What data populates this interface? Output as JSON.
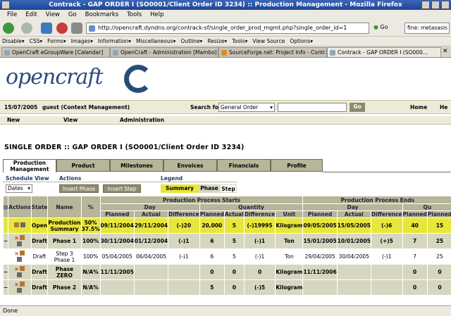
{
  "window": {
    "title": "Contrack - GAP ORDER I (SO0001/Client Order ID 3234) :: Production Management - Mozilla Firefox"
  },
  "menu": [
    "File",
    "Edit",
    "View",
    "Go",
    "Bookmarks",
    "Tools",
    "Help"
  ],
  "nav": {
    "url": "http://opencraft.dyndns.org/contrack-sf/single_order_prod_mgmt.php?single_order_id=1",
    "go": "Go",
    "search_value": "fine: metasasis"
  },
  "bookmarks": [
    "Disable▾",
    "CSS▾",
    "Forms▾",
    "Images▾",
    "Information▾",
    "Miscellaneous▾",
    "Outline▾",
    "Resize▾",
    "Tools▾",
    "View Source",
    "Options▾"
  ],
  "tabs": [
    {
      "label": "OpenCraft eGroupWare [Calendar]"
    },
    {
      "label": "OpenCraft - Administration [Mambo]"
    },
    {
      "label": "SourceForge.net: Project Info - Contr..."
    },
    {
      "label": "Contrack - GAP ORDER I (SO000..."
    }
  ],
  "logo": {
    "text": "opencraft"
  },
  "infobar": {
    "date": "15/07/2005",
    "user": "guest (Context Management)",
    "search_label": "Search for",
    "search_select": "General Order",
    "search_button": "Go",
    "home": "Home",
    "help": "He"
  },
  "appnav": [
    "New",
    "View",
    "Administration"
  ],
  "page_title": "SINGLE ORDER :: GAP ORDER I (SO0001/Client Order ID 3234)",
  "page_tabs": [
    {
      "label": "Production Management"
    },
    {
      "label": "Product"
    },
    {
      "label": "Milestones"
    },
    {
      "label": "Envoices"
    },
    {
      "label": "Financials"
    },
    {
      "label": "Profile"
    }
  ],
  "controls": {
    "schedule_view_label": "Schedule View",
    "schedule_select": "Dates",
    "actions_label": "Actions",
    "insert_phase": "Insert Phase",
    "insert_step": "Insert Step",
    "legend_label": "Legend",
    "legend_summary": "Summary",
    "legend_phase": "Phase",
    "legend_step": "Step"
  },
  "table": {
    "group_starts": "Production Process Starts",
    "group_ends": "Production Process Ends",
    "day": "Day",
    "quantity": "Quantity",
    "quantity_cut": "Qu",
    "cols": {
      "actions": "Actions",
      "state": "State",
      "name": "Name",
      "pct": "%",
      "planned": "Planned",
      "actual": "Actual",
      "difference": "Difference",
      "unit": "Unit"
    },
    "rows": [
      {
        "type": "summary",
        "mark": "",
        "state": "Open",
        "name": "Production Summary",
        "pct": "50% 37.5%",
        "s_planned": "09/11/2004",
        "s_actual": "29/11/2004",
        "s_diff": "(-)20",
        "q_planned": "20,000",
        "q_actual": "5",
        "q_diff": "(-)19995",
        "unit": "Kilogram",
        "e_planned": "09/05/2005",
        "e_actual": "15/05/2005",
        "e_diff": "(-)6",
        "e_qp": "40",
        "e_qa": "15"
      },
      {
        "type": "phase",
        "mark": "−",
        "state": "Draft",
        "name": "Phase 1",
        "pct": "100%",
        "s_planned": "30/11/2004",
        "s_actual": "01/12/2004",
        "s_diff": "(-)1",
        "q_planned": "6",
        "q_actual": "5",
        "q_diff": "(-)1",
        "unit": "Ton",
        "e_planned": "15/01/2005",
        "e_actual": "10/01/2005",
        "e_diff": "(+)5",
        "e_qp": "7",
        "e_qa": "25"
      },
      {
        "type": "step",
        "mark": "",
        "state": "Draft",
        "name": "Step 3 Phase 1",
        "pct": "100%",
        "s_planned": "05/04/2005",
        "s_actual": "06/04/2005",
        "s_diff": "(-)1",
        "q_planned": "6",
        "q_actual": "5",
        "q_diff": "(-)1",
        "unit": "Ton",
        "e_planned": "29/04/2005",
        "e_actual": "30/04/2005",
        "e_diff": "(-)1",
        "e_qp": "7",
        "e_qa": "25"
      },
      {
        "type": "phase",
        "mark": "−",
        "state": "Draft",
        "name": "Phase ZERO",
        "pct": "N/A%",
        "s_planned": "11/11/2005",
        "s_actual": "",
        "s_diff": "",
        "q_planned": "0",
        "q_actual": "0",
        "q_diff": "0",
        "unit": "Kilogram",
        "e_planned": "11/11/2006",
        "e_actual": "",
        "e_diff": "",
        "e_qp": "0",
        "e_qa": "0"
      },
      {
        "type": "phase",
        "mark": "−",
        "state": "Draft",
        "name": "Phase 2",
        "pct": "N/A%",
        "s_planned": "",
        "s_actual": "",
        "s_diff": "",
        "q_planned": "5",
        "q_actual": "0",
        "q_diff": "(-)5",
        "unit": "Kilogram",
        "e_planned": "",
        "e_actual": "",
        "e_diff": "",
        "e_qp": "0",
        "e_qa": "0"
      }
    ]
  },
  "status": "Done",
  "colors": {
    "summary_row": "#e7e63a",
    "phase_row": "#d7d6c1",
    "header": "#b7b59a",
    "titlebar": "#1d4592"
  }
}
